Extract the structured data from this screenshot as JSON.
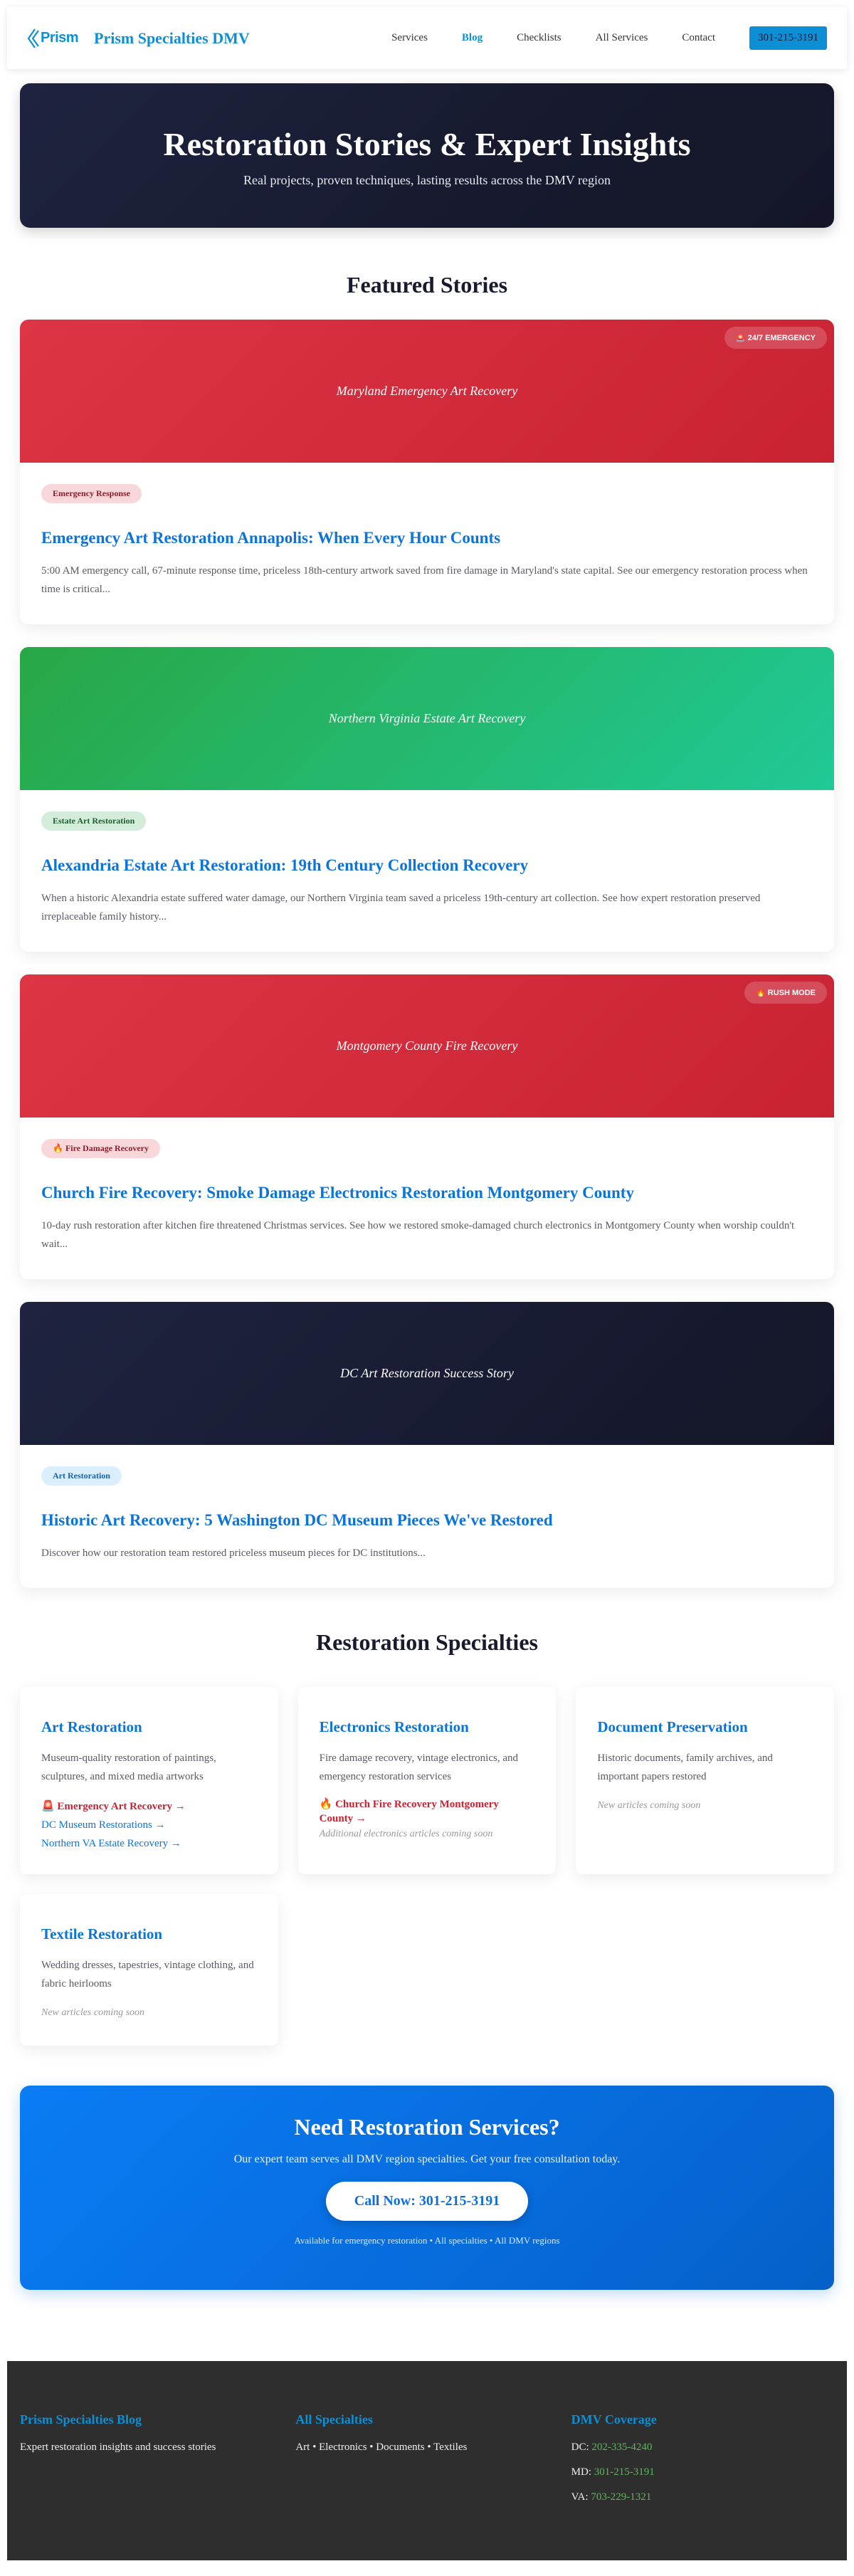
{
  "header": {
    "logo_text": "Prism",
    "brand": "Prism Specialties DMV",
    "nav": [
      "Services",
      "Blog",
      "Checklists",
      "All Services",
      "Contact"
    ],
    "active_nav": "Blog",
    "phone_button": "301-215-3191"
  },
  "hero": {
    "title": "Restoration Stories & Expert Insights",
    "subtitle": "Real projects, proven techniques, lasting results across the DMV region"
  },
  "featured": {
    "title": "Featured Stories",
    "stories": [
      {
        "banner_caption": "Maryland Emergency Art Recovery",
        "banner_badge": "🚨 24/7 EMERGENCY",
        "tag": "Emergency Response",
        "title": "Emergency Art Restoration Annapolis: When Every Hour Counts",
        "excerpt": "5:00 AM emergency call, 67-minute response time, priceless 18th-century artwork saved from fire damage in Maryland's state capital. See our emergency restoration process when time is critical..."
      },
      {
        "banner_caption": "Northern Virginia Estate Art Recovery",
        "banner_badge": "",
        "tag": "Estate Art Restoration",
        "title": "Alexandria Estate Art Restoration: 19th Century Collection Recovery",
        "excerpt": "When a historic Alexandria estate suffered water damage, our Northern Virginia team saved a priceless 19th-century art collection. See how expert restoration preserved irreplaceable family history..."
      },
      {
        "banner_caption": "Montgomery County Fire Recovery",
        "banner_badge": "🔥 RUSH MODE",
        "tag": "🔥 Fire Damage Recovery",
        "title": "Church Fire Recovery: Smoke Damage Electronics Restoration Montgomery County",
        "excerpt": "10-day rush restoration after kitchen fire threatened Christmas services. See how we restored smoke-damaged church electronics in Montgomery County when worship couldn't wait..."
      },
      {
        "banner_caption": "DC Art Restoration Success Story",
        "banner_badge": "",
        "tag": "Art Restoration",
        "title": "Historic Art Recovery: 5 Washington DC Museum Pieces We've Restored",
        "excerpt": "Discover how our restoration team restored priceless museum pieces for DC institutions..."
      }
    ]
  },
  "specialties": {
    "title": "Restoration Specialties",
    "art": {
      "title": "Art Restoration",
      "desc": "Museum-quality restoration of paintings, sculptures, and mixed media artworks",
      "links": [
        "🚨 Emergency Art Recovery →",
        "DC Museum Restorations →",
        "Northern VA Estate Recovery →"
      ]
    },
    "electronics": {
      "title": "Electronics Restoration",
      "desc": "Fire damage recovery, vintage electronics, and emergency restoration services",
      "link": "🔥 Church Fire Recovery Montgomery County →",
      "coming": "Additional electronics articles coming soon"
    },
    "documents": {
      "title": "Document Preservation",
      "desc": "Historic documents, family archives, and important papers restored",
      "coming": "New articles coming soon"
    },
    "textiles": {
      "title": "Textile Restoration",
      "desc": "Wedding dresses, tapestries, vintage clothing, and fabric heirlooms",
      "coming": "New articles coming soon"
    }
  },
  "cta": {
    "title": "Need Restoration Services?",
    "text": "Our expert team serves all DMV region specialties. Get your free consultation today.",
    "button": "Call Now: 301-215-3191",
    "note": "Available for emergency restoration • All specialties • All DMV regions"
  },
  "footer": {
    "col1_title": "Prism Specialties Blog",
    "col1_text": "Expert restoration insights and success stories",
    "col2_title": "All Specialties",
    "col2_text": "Art • Electronics • Documents • Textiles",
    "col3_title": "DMV Coverage",
    "dc_label": "DC:",
    "dc_phone": "202-335-4240",
    "md_label": "MD:",
    "md_phone": "301-215-3191",
    "va_label": "VA:",
    "va_phone": "703-229-1321"
  },
  "colors": {
    "brand_blue": "#0d8fd6",
    "link_blue": "#0b74da",
    "emergency_red": "#dc3545",
    "success_green": "#28a745",
    "navy": "#1a1a2e"
  }
}
